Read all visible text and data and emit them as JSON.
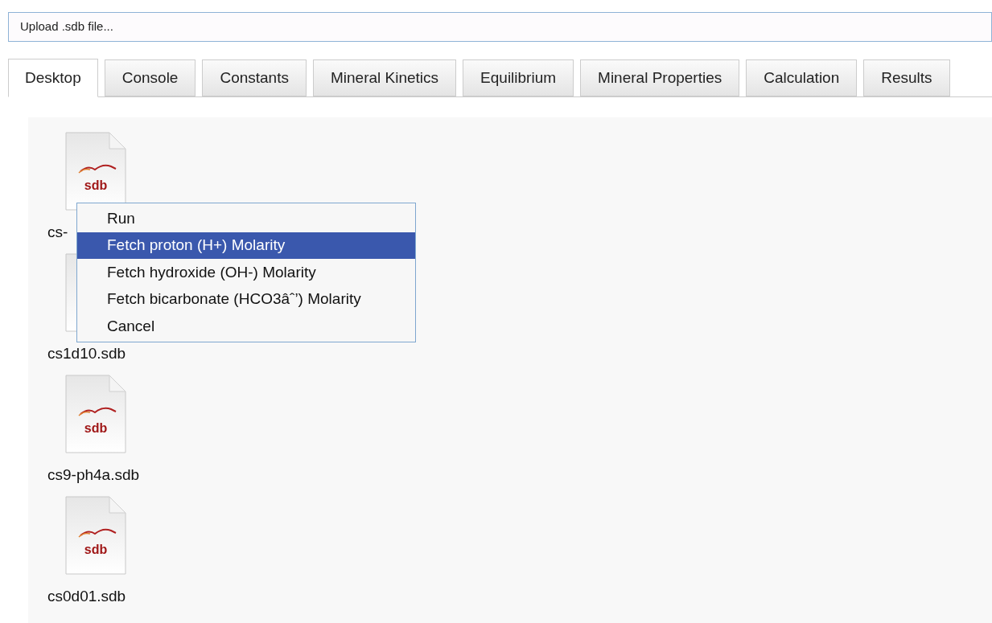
{
  "upload": {
    "label": "Upload .sdb file..."
  },
  "tabs": [
    {
      "label": "Desktop",
      "selected": true
    },
    {
      "label": "Console",
      "selected": false
    },
    {
      "label": "Constants",
      "selected": false
    },
    {
      "label": "Mineral Kinetics",
      "selected": false
    },
    {
      "label": "Equilibrium",
      "selected": false
    },
    {
      "label": "Mineral Properties",
      "selected": false
    },
    {
      "label": "Calculation",
      "selected": false
    },
    {
      "label": "Results",
      "selected": false
    }
  ],
  "files": [
    {
      "name": "cs-",
      "icon_text": "sdb"
    },
    {
      "name": "cs1d10.sdb"
    },
    {
      "name": "cs9-ph4a.sdb",
      "icon_text": "sdb"
    },
    {
      "name": "cs0d01.sdb",
      "icon_text": "sdb"
    }
  ],
  "context_menu": {
    "items": [
      {
        "label": "Run",
        "selected": false
      },
      {
        "label": "Fetch proton (H+) Molarity",
        "selected": true
      },
      {
        "label": "Fetch hydroxide (OH-) Molarity",
        "selected": false
      },
      {
        "label": "Fetch bicarbonate (HCO3âˆ’) Molarity",
        "selected": false
      },
      {
        "label": "Cancel",
        "selected": false
      }
    ]
  }
}
